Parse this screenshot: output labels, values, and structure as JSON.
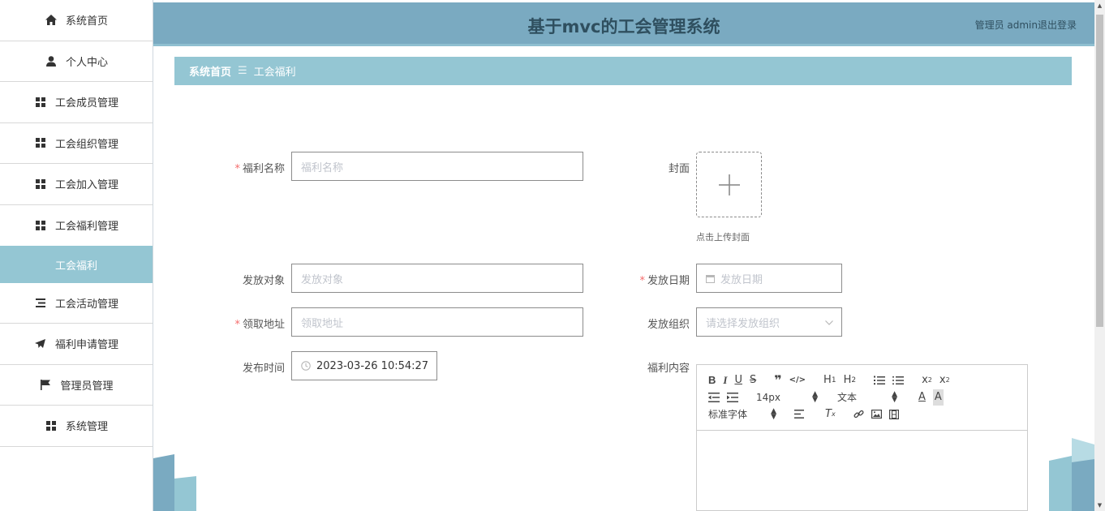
{
  "sidebar": {
    "items": [
      {
        "label": "系统首页",
        "icon": "home-icon"
      },
      {
        "label": "个人中心",
        "icon": "user-icon"
      },
      {
        "label": "工会成员管理",
        "icon": "grid-icon"
      },
      {
        "label": "工会组织管理",
        "icon": "grid-icon"
      },
      {
        "label": "工会加入管理",
        "icon": "grid-icon"
      },
      {
        "label": "工会福利管理",
        "icon": "grid-icon"
      },
      {
        "label": "工会活动管理",
        "icon": "list-icon"
      },
      {
        "label": "福利申请管理",
        "icon": "send-icon"
      },
      {
        "label": "管理员管理",
        "icon": "flag-icon"
      },
      {
        "label": "系统管理",
        "icon": "grid-icon"
      }
    ],
    "active_sub": "工会福利"
  },
  "header": {
    "title": "基于mvc的工会管理系统",
    "user": "管理员 admin",
    "logout": "退出登录"
  },
  "breadcrumb": {
    "home": "系统首页",
    "sep": "☰",
    "current": "工会福利"
  },
  "form": {
    "name": {
      "label": "福利名称",
      "placeholder": "福利名称"
    },
    "cover": {
      "label": "封面",
      "tip": "点击上传封面"
    },
    "target": {
      "label": "发放对象",
      "placeholder": "发放对象"
    },
    "date": {
      "label": "发放日期",
      "placeholder": "发放日期"
    },
    "address": {
      "label": "领取地址",
      "placeholder": "领取地址"
    },
    "org": {
      "label": "发放组织",
      "placeholder": "请选择发放组织"
    },
    "publish_time": {
      "label": "发布时间",
      "value": "2023-03-26 10:54:27"
    },
    "content": {
      "label": "福利内容"
    }
  },
  "editor": {
    "font_size": "14px",
    "text_type": "文本",
    "font_family": "标准字体"
  },
  "colors": {
    "accent": "#94c6d3",
    "header": "#7aaac1",
    "required": "#f56c6c"
  }
}
